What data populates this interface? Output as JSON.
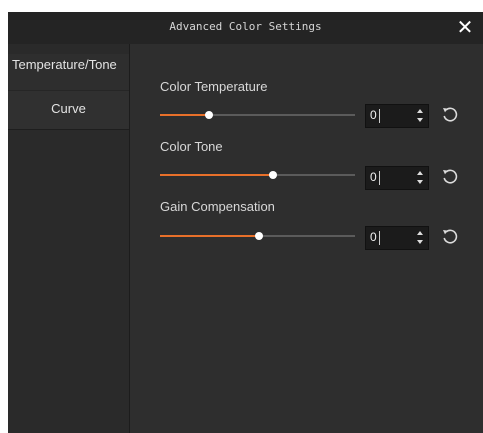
{
  "window": {
    "title": "Advanced Color Settings"
  },
  "tabs": [
    {
      "label": "Temperature/Tone"
    },
    {
      "label": "Curve"
    }
  ],
  "settings": [
    {
      "label": "Color Temperature",
      "value": "0",
      "slider_fraction": 0.25
    },
    {
      "label": "Color Tone",
      "value": "0",
      "slider_fraction": 0.58
    },
    {
      "label": "Gain Compensation",
      "value": "0",
      "slider_fraction": 0.51
    }
  ],
  "colors": {
    "accent": "#e8702a",
    "background": "#2e2e2e",
    "titlebar": "#242424"
  },
  "icons": {
    "close": "close-icon",
    "reset": "reset-icon",
    "spin_up": "chevron-up-icon",
    "spin_down": "chevron-down-icon"
  }
}
